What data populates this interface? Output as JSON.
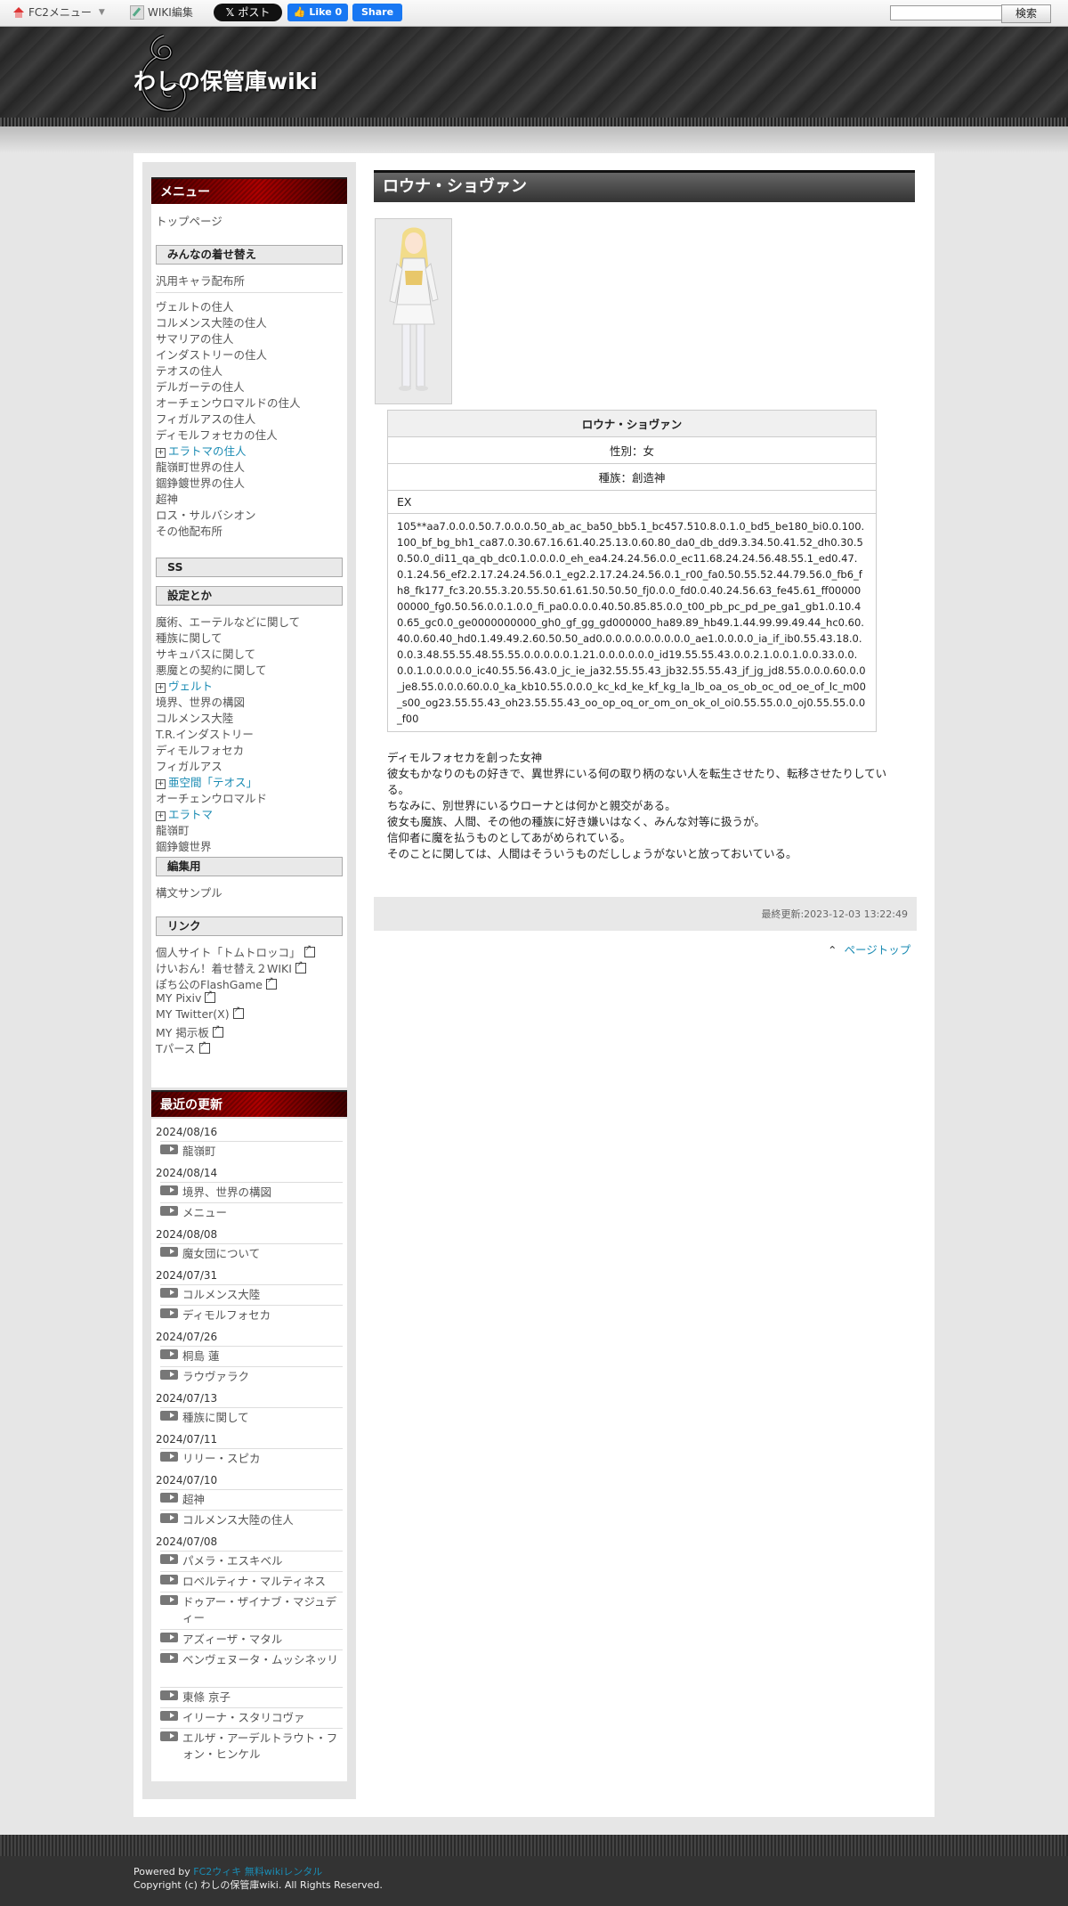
{
  "topbar": {
    "fc2_menu": "FC2メニュー",
    "wiki_edit": "WIKI編集",
    "x_post": "ポスト",
    "fb_like": "Like 0",
    "fb_share": "Share",
    "search_button": "検索",
    "search_value": ""
  },
  "header": {
    "site_title": "わしの保管庫wiki"
  },
  "sidebar": {
    "menu_title": "メニュー",
    "top_page": "トップページ",
    "sec_kisekae": "みんなの着せ替え",
    "generic_chars": "汎用キャラ配布所",
    "kisekae_items": [
      "ヴェルトの住人",
      "コルメンス大陸の住人",
      "サマリアの住人",
      "インダストリーの住人",
      "テオスの住人",
      "デルガーテの住人",
      "オーチェンウロマルドの住人",
      "フィガルアスの住人",
      "ディモルフォセカの住人",
      "エラトマの住人",
      "龍嶺町世界の住人",
      "錮錚鍍世界の住人",
      "超神",
      "ロス・サルバシオン",
      "その他配布所"
    ],
    "sec_ss": "SS",
    "sec_settei": "設定とか",
    "settei_items": [
      "魔術、エーテルなどに関して",
      "種族に関して",
      "サキュバスに関して",
      "悪魔との契約に関して",
      "ヴェルト",
      "境界、世界の構図",
      "コルメンス大陸",
      "T.R.インダストリー",
      "ディモルフォセカ",
      "フィガルアス",
      "亜空間「テオス」",
      "オーチェンウロマルド",
      "エラトマ",
      "龍嶺町",
      "錮錚鍍世界"
    ],
    "sec_edit": "編集用",
    "syntax_sample": "構文サンプル",
    "sec_links": "リンク",
    "links": [
      "個人サイト「トムトロッコ」",
      "けいおん！着せ替え２WIKI",
      "ぽち公のFlashGame",
      "MY Pixiv",
      "MY Twitter(X)",
      "MY 掲示板",
      "Tパース"
    ],
    "recent_title": "最近の更新",
    "recent": [
      {
        "date": "2024/08/16",
        "items": [
          "龍嶺町"
        ]
      },
      {
        "date": "2024/08/14",
        "items": [
          "境界、世界の構図",
          "メニュー"
        ]
      },
      {
        "date": "2024/08/08",
        "items": [
          "魔女団について"
        ]
      },
      {
        "date": "2024/07/31",
        "items": [
          "コルメンス大陸",
          "ディモルフォセカ"
        ]
      },
      {
        "date": "2024/07/26",
        "items": [
          "桐島 蓮",
          "ラウヴァラク"
        ]
      },
      {
        "date": "2024/07/13",
        "items": [
          "種族に関して"
        ]
      },
      {
        "date": "2024/07/11",
        "items": [
          "リリー・スピカ"
        ]
      },
      {
        "date": "2024/07/10",
        "items": [
          "超神",
          "コルメンス大陸の住人"
        ]
      },
      {
        "date": "2024/07/08",
        "items": [
          "パメラ・エスキベル",
          "ロベルティナ・マルティネス",
          "ドゥアー・ザイナブ・マジュディー",
          "アズィーザ・マタル",
          "ベンヴェヌータ・ムッシネッリ",
          "東條 京子",
          "イリーナ・スタリコヴァ",
          "エルザ・アーデルトラウト・フォン・ヒンケル"
        ]
      }
    ]
  },
  "main": {
    "page_title": "ロウナ・ショヴァン",
    "table": {
      "name": "ロウナ・ショヴァン",
      "gender": "性別：女",
      "race": "種族：創造神",
      "ex_label": "EX",
      "code": "105**aa7.0.0.0.50.7.0.0.0.50_ab_ac_ba50_bb5.1_bc457.510.8.0.1.0_bd5_be180_bi0.0.100.100_bf_bg_bh1_ca87.0.30.67.16.61.40.25.13.0.60.80_da0_db_dd9.3.34.50.41.52_dh0.30.50.50.0_di11_qa_qb_dc0.1.0.0.0.0_eh_ea4.24.24.56.0.0_ec11.68.24.24.56.48.55.1_ed0.47.0.1.24.56_ef2.2.17.24.24.56.0.1_eg2.2.17.24.24.56.0.1_r00_fa0.50.55.52.44.79.56.0_fb6_fh8_fk177_fc3.20.55.3.20.55.50.61.61.50.50.50_fj0.0.0_fd0.0.40.24.56.63_fe45.61_ff0000000000_fg0.50.56.0.0.1.0.0_fi_pa0.0.0.0.40.50.85.85.0.0_t00_pb_pc_pd_pe_ga1_gb1.0.10.40.65_gc0.0_ge0000000000_gh0_gf_gg_gd000000_ha89.89_hb49.1.44.99.99.49.44_hc0.60.40.0.60.40_hd0.1.49.49.2.60.50.50_ad0.0.0.0.0.0.0.0.0.0_ae1.0.0.0.0_ia_if_ib0.55.43.18.0.0.0.3.48.55.55.48.55.55.0.0.0.0.0.1.21.0.0.0.0.0.0_id19.55.55.43.0.0.2.1.0.0.1.0.0.33.0.0.0.0.1.0.0.0.0.0_ic40.55.56.43.0_jc_ie_ja32.55.55.43_jb32.55.55.43_jf_jg_jd8.55.0.0.0.60.0.0_je8.55.0.0.0.60.0.0_ka_kb10.55.0.0.0_kc_kd_ke_kf_kg_la_lb_oa_os_ob_oc_od_oe_of_lc_m00_s00_og23.55.55.43_oh23.55.55.43_oo_op_oq_or_om_on_ok_ol_oi0.55.55.0.0_oj0.55.55.0.0_f00"
    },
    "description": [
      "ディモルフォセカを創った女神",
      "彼女もかなりのもの好きで、異世界にいる何の取り柄のない人を転生させたり、転移させたりしている。",
      "ちなみに、別世界にいるウローナとは何かと親交がある。",
      "彼女も魔族、人間、その他の種族に好き嫌いはなく、みんな対等に扱うが。",
      "信仰者に魔を払うものとしてあがめられている。",
      "そのことに関しては、人間はそういうものだししょうがないと放っておいている。"
    ],
    "last_modified": "最終更新:2023-12-03 13:22:49",
    "page_top": "ページトップ"
  },
  "footer": {
    "powered_by": "Powered by",
    "powered_link": "FC2ウィキ 無料wikiレンタル",
    "copyright": "Copyright (c) わしの保管庫wiki. All Rights Reserved."
  },
  "colors": {
    "accent_link": "#1a8bb3",
    "menu_red": "#b00000",
    "header_dark": "#2b2b2b"
  }
}
